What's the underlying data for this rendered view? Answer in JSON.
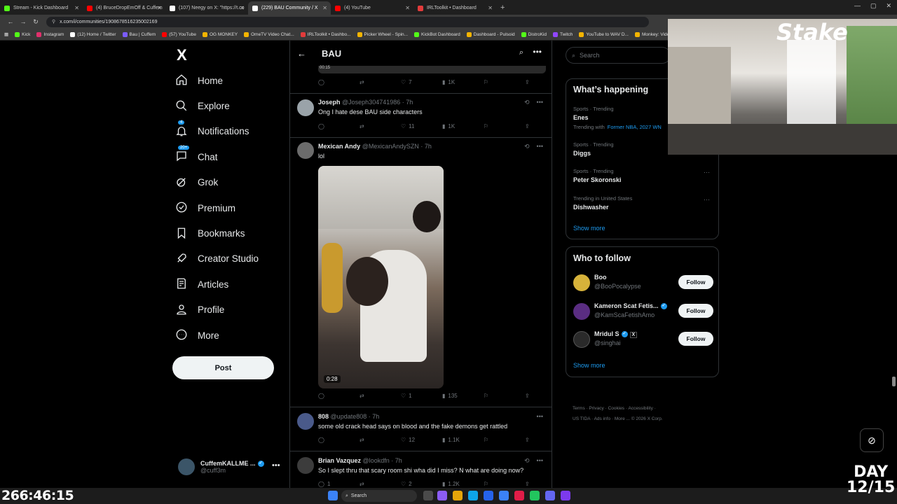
{
  "browser": {
    "tabs": [
      {
        "title": "Stream - Kick Dashboard",
        "color": "#53fc18"
      },
      {
        "title": "(4) BruceDropEmOff & Cuffem",
        "color": "#ff0000"
      },
      {
        "title": "(107) Neegy on X: \"https://t.co",
        "color": "#ffffff"
      },
      {
        "title": "(229) BAU Community / X",
        "color": "#ffffff"
      },
      {
        "title": "(4) YouTube",
        "color": "#ff0000"
      },
      {
        "title": "IRLToolkit • Dashboard",
        "color": "#e23b3b"
      }
    ],
    "url": "x.com/i/communities/1908678516235002169",
    "bookmarks": [
      {
        "label": "Kick",
        "color": "#53fc18"
      },
      {
        "label": "Instagram",
        "color": "#e1306c"
      },
      {
        "label": "(12) Home / Twitter",
        "color": "#ffffff"
      },
      {
        "label": "Bau | Cuffem",
        "color": "#7b5cff"
      },
      {
        "label": "(57) YouTube",
        "color": "#ff0000"
      },
      {
        "label": "OG MONKEY",
        "color": "#f4b400"
      },
      {
        "label": "OmeTV Video Chat...",
        "color": "#f4b400"
      },
      {
        "label": "IRLToolkit • Dashbo...",
        "color": "#e23b3b"
      },
      {
        "label": "Picker Wheel - Spin...",
        "color": "#f4b400"
      },
      {
        "label": "KickBot Dashboard",
        "color": "#53fc18"
      },
      {
        "label": "Dashboard - Pulsoid",
        "color": "#f4b400"
      },
      {
        "label": "DistroKid",
        "color": "#53fc18"
      },
      {
        "label": "Twitch",
        "color": "#9146ff"
      },
      {
        "label": "YouTube to WAV D...",
        "color": "#f4b400"
      },
      {
        "label": "Monkey: Video Chat...",
        "color": "#f4b400"
      }
    ]
  },
  "sidebar": {
    "logo": "X",
    "items": [
      {
        "label": "Home",
        "icon": "home-icon"
      },
      {
        "label": "Explore",
        "icon": "search-icon"
      },
      {
        "label": "Notifications",
        "icon": "bell-icon",
        "badge": "4"
      },
      {
        "label": "Chat",
        "icon": "chat-icon",
        "badge": "20+"
      },
      {
        "label": "Grok",
        "icon": "grok-icon"
      },
      {
        "label": "Premium",
        "icon": "premium-icon"
      },
      {
        "label": "Bookmarks",
        "icon": "bookmark-icon"
      },
      {
        "label": "Creator Studio",
        "icon": "rocket-icon"
      },
      {
        "label": "Articles",
        "icon": "articles-icon"
      },
      {
        "label": "Profile",
        "icon": "person-icon"
      },
      {
        "label": "More",
        "icon": "more-circle-icon"
      }
    ],
    "post_label": "Post",
    "account": {
      "name": "CuffemKALLME ...",
      "handle": "@cuff3m"
    }
  },
  "community": {
    "title": "BAU",
    "top_video_time": "00:15",
    "first_actions": {
      "reply": "",
      "repost": "",
      "like": "7",
      "views": "1K"
    },
    "tweets": [
      {
        "name": "Joseph",
        "handle": "@Joseph304741986 · 7h",
        "text": "Ong I hate dese BAU side characters",
        "like": "11",
        "views": "1K"
      },
      {
        "name": "Mexican Andy",
        "handle": "@MexicanAndySZN · 7h",
        "text": "lol",
        "video_duration": "0:28",
        "like": "1",
        "views": "135"
      },
      {
        "name": "808",
        "handle": "@update808 · 7h",
        "text": "some old crack head says on blood and the fake demons  get rattled",
        "like": "12",
        "views": "1.1K"
      },
      {
        "name": "Brian Vazquez",
        "handle": "@lookdfn · 7h",
        "text": "So I slept thru that scary room shi wha did I miss? N what are doing now?",
        "reply": "1",
        "like": "2",
        "views": "1.2K"
      }
    ]
  },
  "right": {
    "search_placeholder": "Search",
    "whats_happening": {
      "title": "What’s happening",
      "items": [
        {
          "meta": "Sports · Trending",
          "name": "Enes",
          "sub": "Trending with",
          "link": "Former NBA, 2027 WN"
        },
        {
          "meta": "Sports · Trending",
          "name": "Diggs"
        },
        {
          "meta": "Sports · Trending",
          "name": "Peter Skoronski"
        },
        {
          "meta": "Trending in United States",
          "name": "Dishwasher"
        }
      ],
      "show_more": "Show more"
    },
    "who_to_follow": {
      "title": "Who to follow",
      "users": [
        {
          "name": "Boo",
          "handle": "@BooPocalypse",
          "color": "#d6b23a"
        },
        {
          "name": "Kameron Scat Fetis...",
          "handle": "@KamScaFetishAmo",
          "color": "#5a2d82"
        },
        {
          "name": "Mridul S",
          "handle": "@singhai",
          "color": "#2a2a2a"
        }
      ],
      "follow_label": "Follow",
      "show_more": "Show more"
    },
    "footer": [
      "Terms",
      "Privacy",
      "Cookies",
      "Accessibility",
      "US TIDA",
      "Ads info",
      "More ...",
      "© 2026 X Corp."
    ]
  },
  "overlay": {
    "webcam_logo": "Stake",
    "timer": "266:46:15",
    "day_label": "DAY",
    "day_value": "12/15"
  },
  "taskbar": {
    "search_label": "Search"
  }
}
